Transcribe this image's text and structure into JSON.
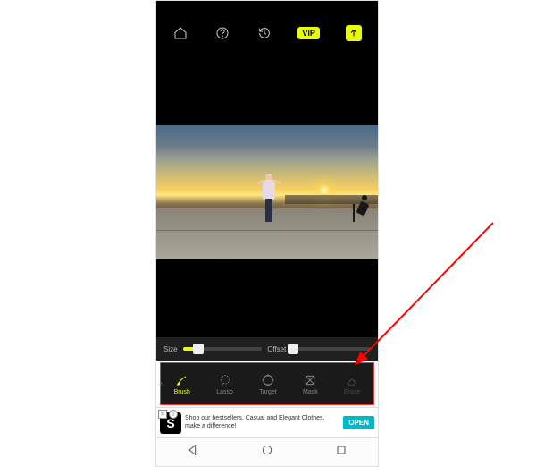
{
  "topbar": {
    "vip_label": "VIP"
  },
  "sliders": {
    "size_label": "Size",
    "size_percent": 20,
    "offset_label": "Offset",
    "offset_percent": 2
  },
  "tools": {
    "brush": "Brush",
    "lasso": "Lasso",
    "target": "Target",
    "mask": "Mask",
    "erase": "Erase"
  },
  "ad": {
    "logo_letter": "S",
    "text": "Shop our bestsellers, Casual and Elegant Clothes, make a difference!",
    "cta": "OPEN"
  },
  "colors": {
    "accent": "#e8ff00",
    "highlight": "#ff3030"
  }
}
